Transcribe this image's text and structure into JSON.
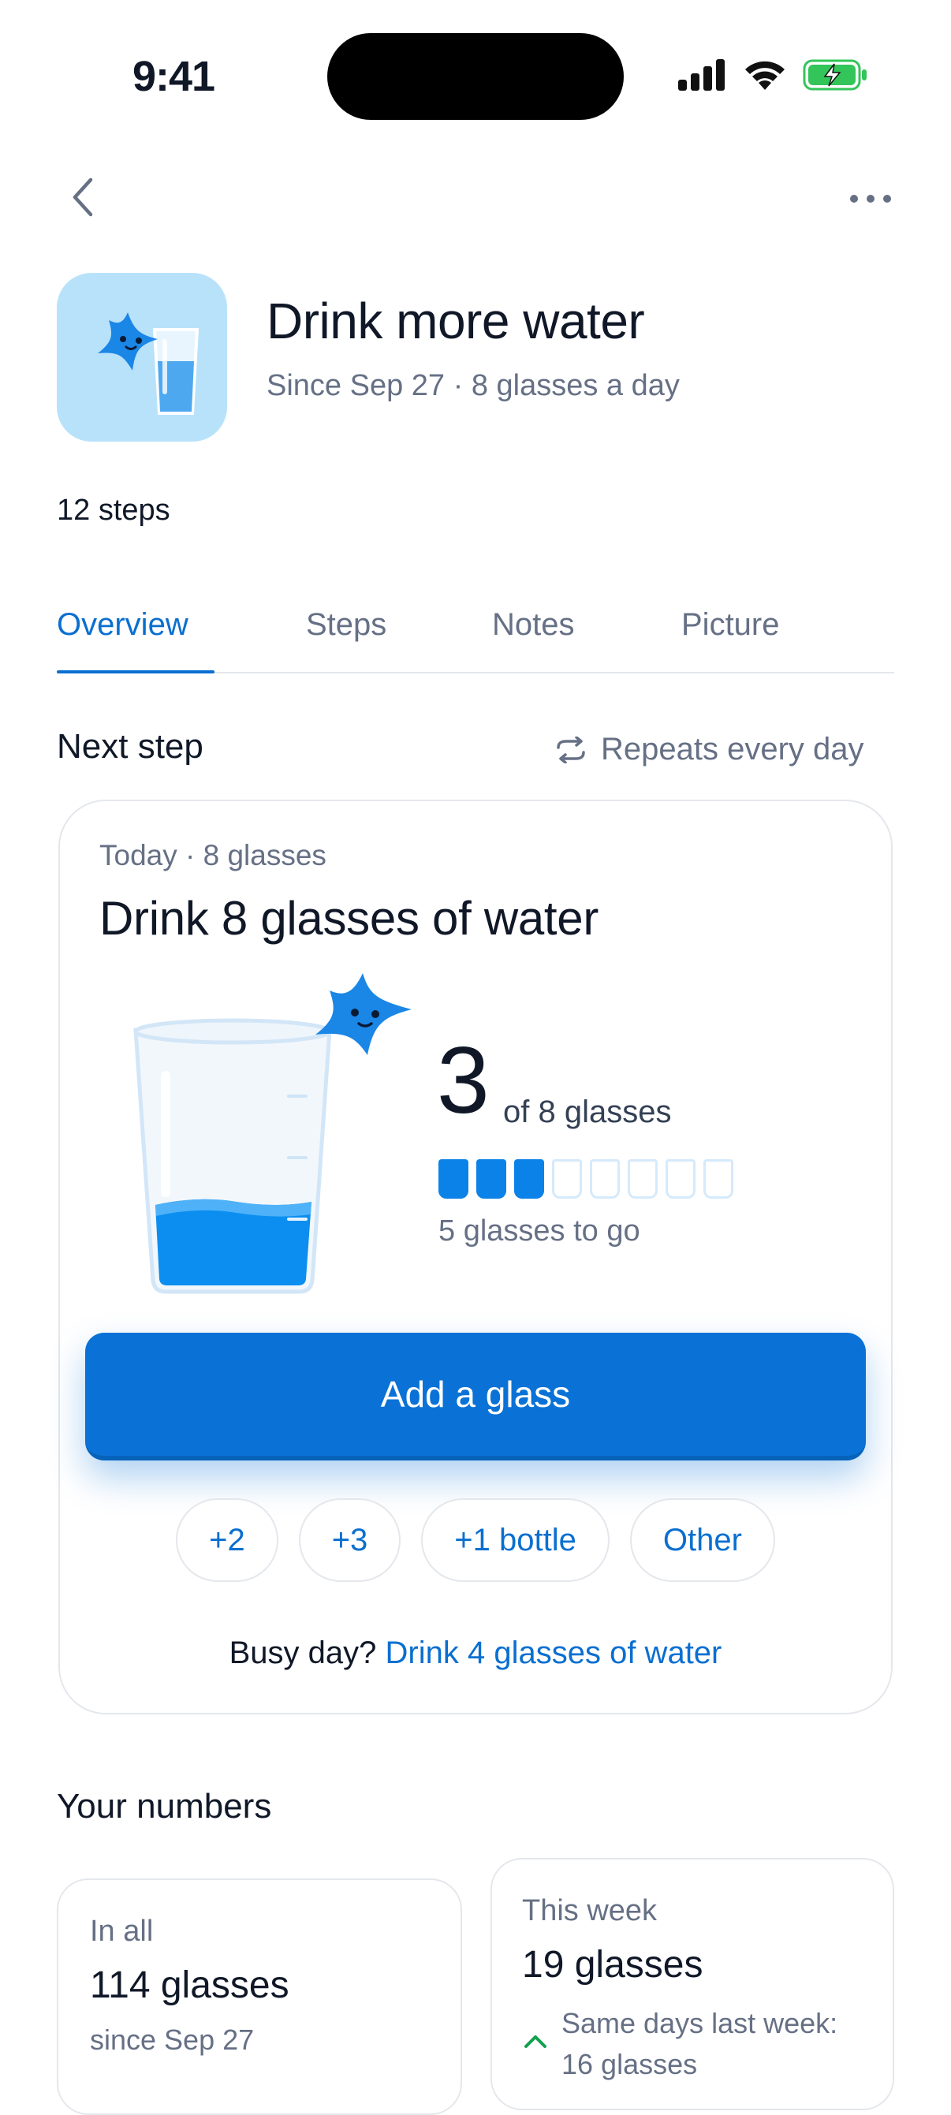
{
  "status_bar": {
    "time": "9:41"
  },
  "habit": {
    "title": "Drink more water",
    "subtitle": "Since Sep 27 · 8 glasses a day",
    "steps_count": "12 steps"
  },
  "tabs": [
    {
      "label": "Overview",
      "active": true
    },
    {
      "label": "Steps",
      "active": false
    },
    {
      "label": "Notes",
      "active": false
    },
    {
      "label": "Picture",
      "active": false
    }
  ],
  "next_step": {
    "section_title": "Next step",
    "repeats": "Repeats every day",
    "card": {
      "meta": "Today · 8 glasses",
      "title": "Drink 8 glasses of water",
      "count": "3",
      "of_text": "of 8 glasses",
      "glasses_done": 3,
      "glasses_total": 8,
      "to_go": "5 glasses to go",
      "add_button": "Add a glass",
      "chips": [
        "+2",
        "+3",
        "+1 bottle",
        "Other"
      ],
      "busy_prefix": "Busy day?",
      "busy_link": "Drink 4 glasses of water"
    }
  },
  "numbers": {
    "section_title": "Your numbers",
    "in_all": {
      "label": "In all",
      "value": "114 glasses",
      "sub": "since Sep 27"
    },
    "this_week": {
      "label": "This week",
      "value": "19 glasses",
      "comparison": "Same days last week:",
      "comparison_value": "16 glasses"
    }
  },
  "colors": {
    "accent": "#0a72d6",
    "water": "#0b82e8",
    "icon_bg": "#b8e2fa",
    "trend_up": "#12a150"
  }
}
